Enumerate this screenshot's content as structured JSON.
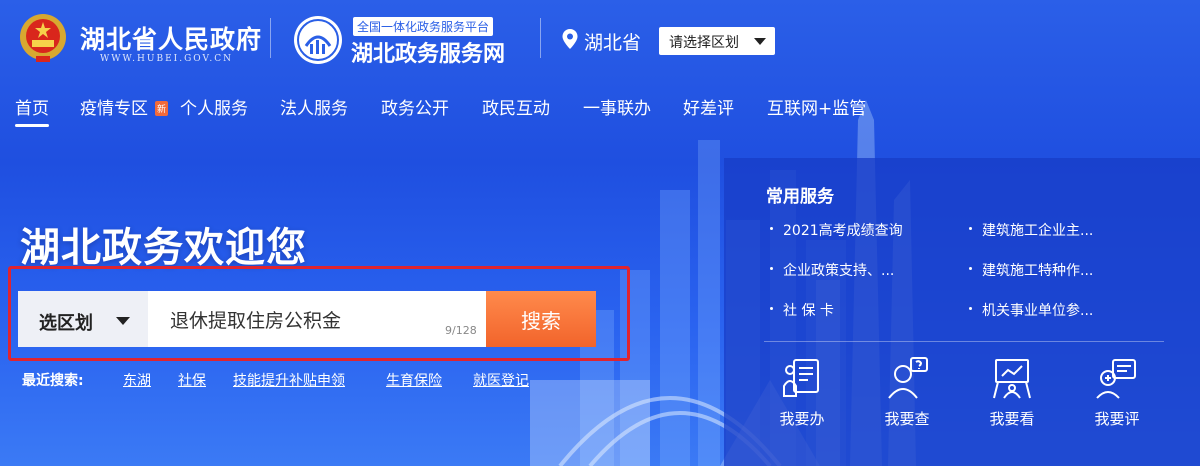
{
  "header": {
    "gov_title": "湖北省人民政府",
    "gov_url": "WWW.HUBEI.GOV.CN",
    "platform_tag": "全国一体化政务服务平台",
    "platform_title": "湖北政务服务网",
    "location": "湖北省",
    "region_select": "请选择区划"
  },
  "nav": {
    "items": [
      {
        "label": "首页"
      },
      {
        "label": "疫情专区"
      },
      {
        "label": "个人服务"
      },
      {
        "label": "法人服务"
      },
      {
        "label": "政务公开"
      },
      {
        "label": "政民互动"
      },
      {
        "label": "一事联办"
      },
      {
        "label": "好差评"
      },
      {
        "label": "互联网+监管"
      }
    ],
    "badge": "新"
  },
  "main": {
    "welcome": "湖北政务欢迎您",
    "area_select": "选区划",
    "search_value": "退休提取住房公积金",
    "counter": "9/128",
    "search_button": "搜索",
    "recent_label": "最近搜索:",
    "recent": [
      "东湖",
      "社保",
      "技能提升补贴申领",
      "生育保险",
      "就医登记"
    ]
  },
  "panel": {
    "title": "常用服务",
    "services": [
      "2021高考成绩查询",
      "建筑施工企业主...",
      "企业政策支持、...",
      "建筑施工特种作...",
      "社 保 卡",
      "机关事业单位参..."
    ],
    "actions": [
      {
        "label": "我要办",
        "icon": "form-icon"
      },
      {
        "label": "我要查",
        "icon": "query-person-icon"
      },
      {
        "label": "我要看",
        "icon": "presentation-icon"
      },
      {
        "label": "我要评",
        "icon": "review-icon"
      }
    ]
  },
  "colors": {
    "background": "#2b5fe8",
    "search_button": "#f2642b",
    "highlight_frame": "#e0242f",
    "panel": "#183ec8"
  }
}
